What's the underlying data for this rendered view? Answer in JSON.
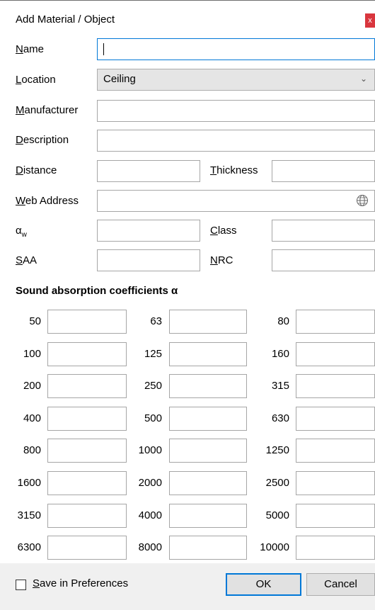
{
  "dialog": {
    "title": "Add Material / Object",
    "close_label": "x"
  },
  "fields": {
    "name": {
      "label_u": "N",
      "label_rest": "ame",
      "value": ""
    },
    "location": {
      "label_u": "L",
      "label_rest": "ocation",
      "value": "Ceiling"
    },
    "manufacturer": {
      "label_u": "M",
      "label_rest": "anufacturer",
      "value": ""
    },
    "description": {
      "label_u": "D",
      "label_rest": "escription",
      "value": ""
    },
    "distance": {
      "label_u": "D",
      "label_rest": "istance",
      "value": ""
    },
    "thickness": {
      "label_u": "T",
      "label_rest": "hickness",
      "value": ""
    },
    "web_address": {
      "label_u": "W",
      "label_rest": "eb Address",
      "value": ""
    },
    "alpha_w": {
      "label_main": "α",
      "label_sub": "w",
      "value": ""
    },
    "class": {
      "label_u": "C",
      "label_rest": "lass",
      "value": ""
    },
    "saa": {
      "label_u": "S",
      "label_rest": "AA",
      "value": ""
    },
    "nrc": {
      "label_u": "N",
      "label_rest": "RC",
      "value": ""
    }
  },
  "coefficients": {
    "heading": "Sound absorption coefficients α",
    "frequencies": [
      "50",
      "63",
      "80",
      "100",
      "125",
      "160",
      "200",
      "250",
      "315",
      "400",
      "500",
      "630",
      "800",
      "1000",
      "1250",
      "1600",
      "2000",
      "2500",
      "3150",
      "4000",
      "5000",
      "6300",
      "8000",
      "10000"
    ]
  },
  "footer": {
    "save_u": "S",
    "save_rest": "ave in Preferences",
    "save_checked": false,
    "ok_label": "OK",
    "cancel_label": "Cancel"
  },
  "icons": {
    "close": "close-icon",
    "dropdown": "chevron-down-icon",
    "web": "globe-icon",
    "checkbox": "checkbox-icon"
  },
  "colors": {
    "accent": "#0078d7",
    "close_bg": "#d9363e",
    "footer_bg": "#f0f0f0",
    "select_bg": "#e5e5e5"
  }
}
